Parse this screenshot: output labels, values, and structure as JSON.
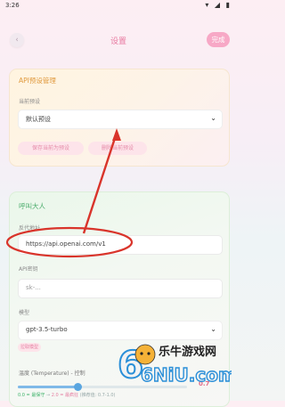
{
  "status": {
    "time": "3:26",
    "icons_text": "▾ ◢ ▮"
  },
  "header": {
    "back_icon": "‹",
    "title": "设置",
    "done_label": "完成"
  },
  "preset_card": {
    "title": "API预设管理",
    "current_label": "当前预设",
    "current_value": "默认预设",
    "save_button": "保存当前为预设",
    "delete_button": "删除当前预设"
  },
  "api_card": {
    "title": "呼叫大人",
    "proxy_label": "反代地址",
    "proxy_value": "https://api.openai.com/v1",
    "key_label": "API密钥",
    "key_placeholder": "sk-...",
    "model_label": "模型",
    "model_value": "gpt-3.5-turbo",
    "fetch_models_chip": "拉取模型",
    "temperature_label": "温度 (Temperature) - 控制",
    "temperature_value": "0.7",
    "temperature_hint_low": "0.0 = 最保守",
    "temperature_hint_high": "2.0 = 最疯狂",
    "temperature_hint_rec": "(推荐值: 0.7-1.0)"
  },
  "slider": {
    "temperature": 0.7,
    "max": 2.0
  },
  "watermark": {
    "text": "乐牛游戏网",
    "mark": "6NiU.com"
  },
  "colors": {
    "accent_pink": "#e879a0",
    "annotation_red": "#d9342b",
    "slider_blue": "#5aa6e0"
  }
}
